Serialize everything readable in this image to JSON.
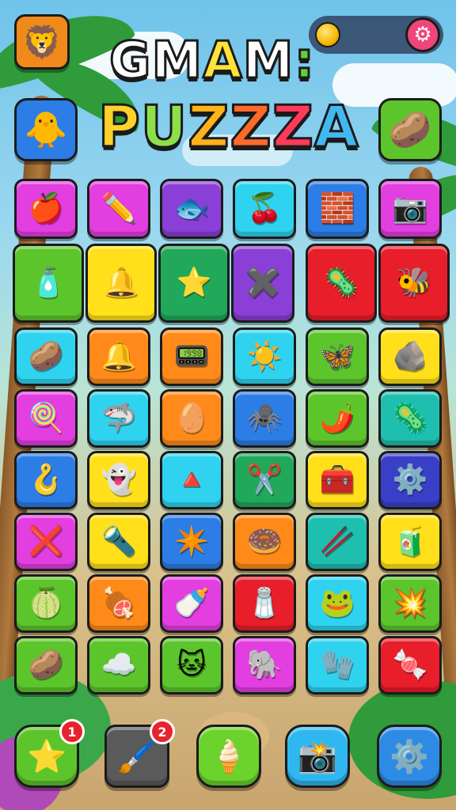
{
  "header": {
    "title_line1": [
      "G",
      "M",
      "A",
      "M",
      ":"
    ],
    "title_line2": [
      "P",
      "U",
      "Z",
      "Z",
      "Z",
      "A"
    ],
    "coin_count": "",
    "settings_icon": "gear-icon"
  },
  "colors": {
    "title_line1": [
      "#ffffff",
      "#ffffff",
      "#ffe23a",
      "#ffffff",
      "#5fd13a"
    ],
    "title_line2": [
      "#ffd12a",
      "#8ee04a",
      "#ffb21a",
      "#ff6a2a",
      "#ff3a5a",
      "#42b8f0"
    ]
  },
  "tile_colors": {
    "magenta": "#e23ee0",
    "purple": "#8a3fd6",
    "cyan": "#2fd3ef",
    "blue": "#2d7de6",
    "green": "#5cc52c",
    "darkgreen": "#22a85a",
    "yellow": "#ffe01a",
    "orange": "#ff8a1a",
    "red": "#e81e2a",
    "navy": "#3a3fc8",
    "teal": "#1fbfb0"
  },
  "grid": {
    "rows": [
      [
        {
          "icon": "🍎",
          "color": "magenta"
        },
        {
          "icon": "✏️",
          "color": "magenta"
        },
        {
          "icon": "🐟",
          "color": "purple"
        },
        {
          "icon": "🍒",
          "color": "cyan"
        },
        {
          "icon": "🧱",
          "color": "blue"
        },
        {
          "icon": "📷",
          "color": "magenta"
        }
      ],
      [
        {
          "icon": "🧴",
          "color": "green"
        },
        {
          "icon": "🔔",
          "color": "yellow"
        },
        {
          "icon": "⭐",
          "color": "darkgreen"
        },
        {
          "icon": "✖️",
          "color": "purple"
        },
        {
          "icon": "🦠",
          "color": "red"
        },
        {
          "icon": "🐝",
          "color": "red"
        }
      ],
      [
        {
          "icon": "🥔",
          "color": "cyan"
        },
        {
          "icon": "🔔",
          "color": "orange"
        },
        {
          "icon": "📟",
          "color": "orange"
        },
        {
          "icon": "☀️",
          "color": "cyan"
        },
        {
          "icon": "🦋",
          "color": "green"
        },
        {
          "icon": "🪨",
          "color": "yellow"
        }
      ],
      [
        {
          "icon": "🍭",
          "color": "magenta"
        },
        {
          "icon": "🦈",
          "color": "cyan"
        },
        {
          "icon": "🥚",
          "color": "orange"
        },
        {
          "icon": "🕷️",
          "color": "blue"
        },
        {
          "icon": "🌶️",
          "color": "green"
        },
        {
          "icon": "🦠",
          "color": "teal"
        }
      ],
      [
        {
          "icon": "🪝",
          "color": "blue"
        },
        {
          "icon": "👻",
          "color": "yellow"
        },
        {
          "icon": "🔺",
          "color": "cyan"
        },
        {
          "icon": "✂️",
          "color": "darkgreen"
        },
        {
          "icon": "🧰",
          "color": "yellow"
        },
        {
          "icon": "⚙️",
          "color": "navy"
        }
      ],
      [
        {
          "icon": "❌",
          "color": "magenta"
        },
        {
          "icon": "🔦",
          "color": "yellow"
        },
        {
          "icon": "✴️",
          "color": "blue"
        },
        {
          "icon": "🍩",
          "color": "orange"
        },
        {
          "icon": "🥢",
          "color": "teal"
        },
        {
          "icon": "🧃",
          "color": "yellow"
        }
      ],
      [
        {
          "icon": "🍈",
          "color": "green"
        },
        {
          "icon": "🍖",
          "color": "orange"
        },
        {
          "icon": "🍼",
          "color": "magenta"
        },
        {
          "icon": "🧂",
          "color": "red"
        },
        {
          "icon": "🐸",
          "color": "cyan"
        },
        {
          "icon": "💥",
          "color": "green"
        }
      ],
      [
        {
          "icon": "🥔",
          "color": "green"
        },
        {
          "icon": "☁️",
          "color": "green"
        },
        {
          "icon": "🐱",
          "color": "green"
        },
        {
          "icon": "🐘",
          "color": "magenta"
        },
        {
          "icon": "🧤",
          "color": "cyan"
        },
        {
          "icon": "🍬",
          "color": "red"
        }
      ]
    ]
  },
  "bottom_bar": [
    {
      "name": "star-button",
      "icon": "⭐",
      "color": "#5cc52c",
      "badge": "1"
    },
    {
      "name": "brush-button",
      "icon": "🖌️",
      "color": "#5a5a5a",
      "badge": "2"
    },
    {
      "name": "ice-cream-button",
      "icon": "🍦",
      "color": "#6cd22c",
      "badge": ""
    },
    {
      "name": "camera-button",
      "icon": "📸",
      "color": "#2fb8f0",
      "badge": ""
    },
    {
      "name": "settings-button",
      "icon": "⚙️",
      "color": "#2d8be6",
      "badge": ""
    }
  ],
  "side_buttons": {
    "top_left_icon": "🦁",
    "left_icon": "🐥",
    "right_icon": "🥔"
  }
}
